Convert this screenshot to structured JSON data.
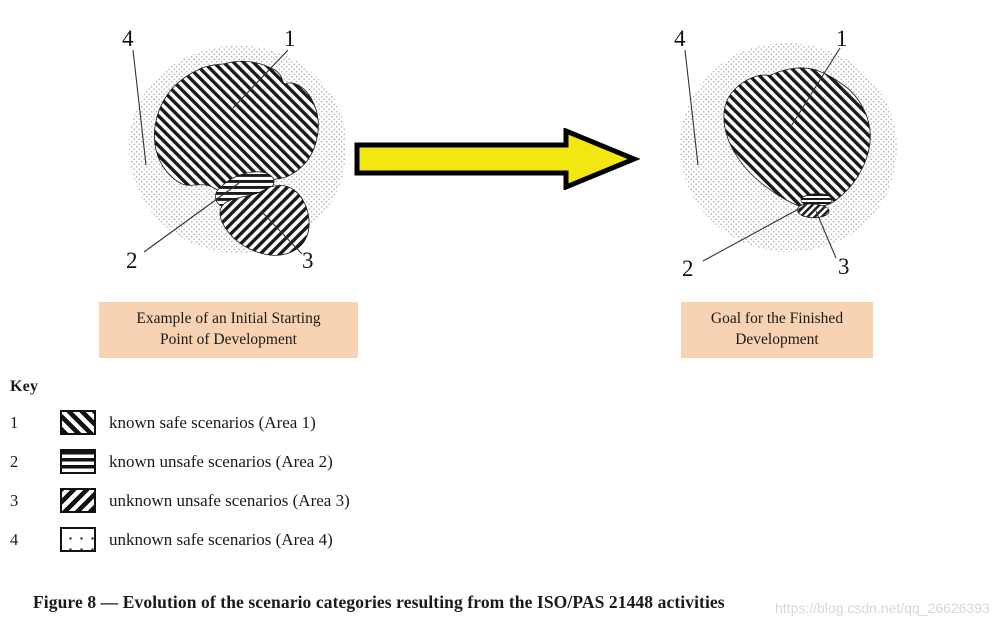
{
  "figure": {
    "caption": "Figure 8 — Evolution of the scenario categories resulting from the ISO/PAS 21448 activities",
    "watermark": "https://blog.csdn.net/qq_26626393"
  },
  "panels": {
    "left": {
      "name": "initial-starting-point",
      "caption": "Example of an Initial Starting Point of Development",
      "caption_line1": "Example of an Initial Starting",
      "caption_line2": "Point of Development",
      "callouts": [
        {
          "id": "1",
          "label": "1",
          "area": "known safe scenarios"
        },
        {
          "id": "2",
          "label": "2",
          "area": "known unsafe scenarios"
        },
        {
          "id": "3",
          "label": "3",
          "area": "unknown unsafe scenarios"
        },
        {
          "id": "4",
          "label": "4",
          "area": "unknown safe scenarios"
        }
      ]
    },
    "right": {
      "name": "finished-development-goal",
      "caption": "Goal for the Finished Development",
      "caption_line1": "Goal for the Finished",
      "caption_line2": "Development",
      "callouts": [
        {
          "id": "1",
          "label": "1",
          "area": "known safe scenarios"
        },
        {
          "id": "2",
          "label": "2",
          "area": "known unsafe scenarios"
        },
        {
          "id": "3",
          "label": "3",
          "area": "unknown unsafe scenarios"
        },
        {
          "id": "4",
          "label": "4",
          "area": "unknown safe scenarios"
        }
      ]
    }
  },
  "arrow": {
    "name": "evolution-arrow",
    "direction": "right",
    "fill_color": "#F2E711",
    "stroke_color": "#000000"
  },
  "key": {
    "title": "Key",
    "items": [
      {
        "num": "1",
        "pattern": "diagonal-up-hatch",
        "text": "known safe scenarios (Area 1)"
      },
      {
        "num": "2",
        "pattern": "horizontal-stripes",
        "text": "known unsafe scenarios (Area 2)"
      },
      {
        "num": "3",
        "pattern": "diagonal-down-hatch",
        "text": "unknown unsafe scenarios (Area 3)"
      },
      {
        "num": "4",
        "pattern": "sparse-dots",
        "text": "unknown safe scenarios (Area 4)"
      }
    ]
  },
  "colors": {
    "caption_box_fill": "#F8D3B3",
    "arrow_yellow": "#F2E711",
    "ink": "#1A1A1A"
  }
}
